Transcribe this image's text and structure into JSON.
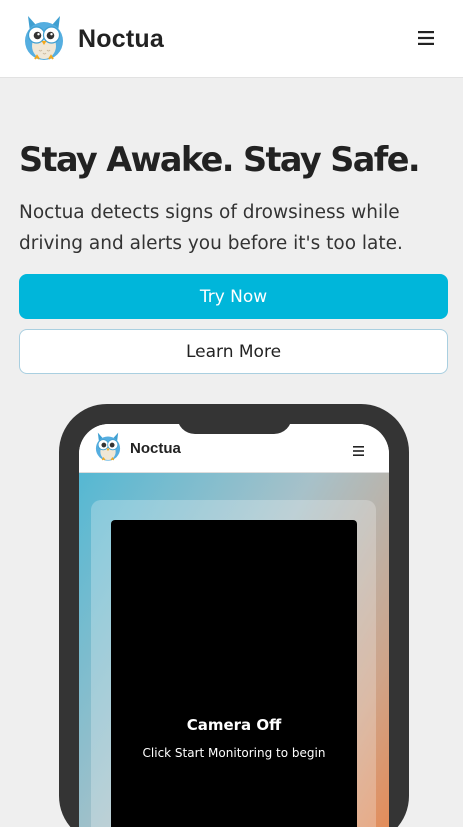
{
  "header": {
    "app_name": "Noctua",
    "logo_icon": "owl-logo-icon",
    "menu_icon": "hamburger-menu-icon"
  },
  "hero": {
    "title": "Stay Awake. Stay Safe.",
    "description": "Noctua detects signs of drowsiness while driving and alerts you before it's too late.",
    "primary_button": "Try Now",
    "secondary_button": "Learn More"
  },
  "phone_preview": {
    "app_name": "Noctua",
    "camera_status": "Camera Off",
    "camera_hint": "Click Start Monitoring to begin"
  },
  "colors": {
    "accent": "#00b6da",
    "page_background": "#efefef",
    "phone_frame": "#343434"
  }
}
